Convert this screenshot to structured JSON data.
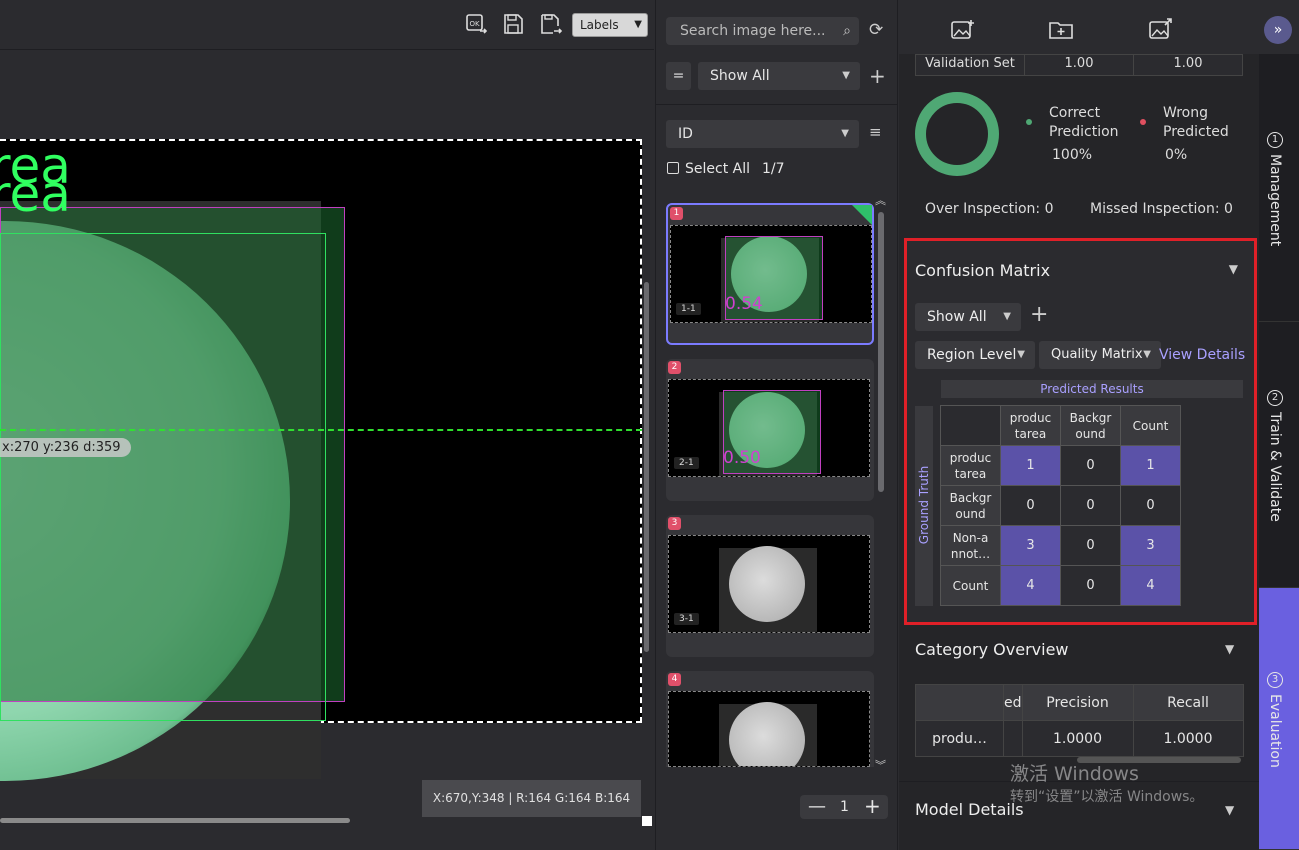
{
  "toolbar": {
    "ok_icon": "ok-export-icon",
    "save_icon": "save-icon",
    "save_as_icon": "save-as-icon",
    "labels_select": "Labels"
  },
  "canvas": {
    "area_text_1": "rea",
    "area_text_2": "rea",
    "measure": "x:270 y:236 d:359",
    "pixel_info": "X:670,Y:348 | R:164 G:164 B:164"
  },
  "thumbs": {
    "search_placeholder": "Search image here...",
    "filter_eq": "=",
    "filter_select": "Show All",
    "sort_select": "ID",
    "select_all": "Select All",
    "count": "1/7",
    "items": [
      {
        "num": "1",
        "sub": "1-1",
        "score": "0.54"
      },
      {
        "num": "2",
        "sub": "2-1",
        "score": "0.50"
      },
      {
        "num": "3",
        "sub": "3-1",
        "score": ""
      },
      {
        "num": "4",
        "sub": "",
        "score": ""
      }
    ],
    "page": "1"
  },
  "right": {
    "validation_label": "Validation Set",
    "validation_v1": "1.00",
    "validation_v2": "1.00",
    "correct_label_1": "Correct",
    "correct_label_2": "Prediction",
    "correct_value": "100%",
    "wrong_label_1": "Wrong",
    "wrong_label_2": "Predicted",
    "wrong_value": "0%",
    "over_inspection": "Over Inspection:  0",
    "missed_inspection": "Missed Inspection:  0",
    "colors": {
      "correct": "#4fa874",
      "wrong": "#e05060",
      "accent": "#6a60e0"
    }
  },
  "cm": {
    "title": "Confusion Matrix",
    "filter": "Show All",
    "level": "Region Level",
    "matrix_type": "Quality Matrix",
    "view_details": "View Details",
    "predicted_results": "Predicted Results",
    "ground_truth": "Ground Truth",
    "col_headers": [
      "produc tarea",
      "Backgr ound",
      "Count"
    ],
    "rows": [
      {
        "label": "produc tarea",
        "cells": [
          "1",
          "0",
          "1"
        ]
      },
      {
        "label": "Backgr ound",
        "cells": [
          "0",
          "0",
          "0"
        ]
      },
      {
        "label": "Non-a nnot…",
        "cells": [
          "3",
          "0",
          "3"
        ]
      },
      {
        "label": "Count",
        "cells": [
          "4",
          "0",
          "4"
        ]
      }
    ]
  },
  "category": {
    "title": "Category Overview",
    "headers": [
      "",
      "ed",
      "Precision",
      "Recall"
    ],
    "row": [
      "produ…",
      "",
      "1.0000",
      "1.0000"
    ]
  },
  "model_details": "Model Details",
  "watermark": {
    "line1": "激活 Windows",
    "line2": "转到“设置”以激活 Windows。"
  },
  "tabs": [
    {
      "num": "1",
      "label": "Management"
    },
    {
      "num": "2",
      "label": "Train & Validate"
    },
    {
      "num": "3",
      "label": "Evaluation"
    }
  ]
}
